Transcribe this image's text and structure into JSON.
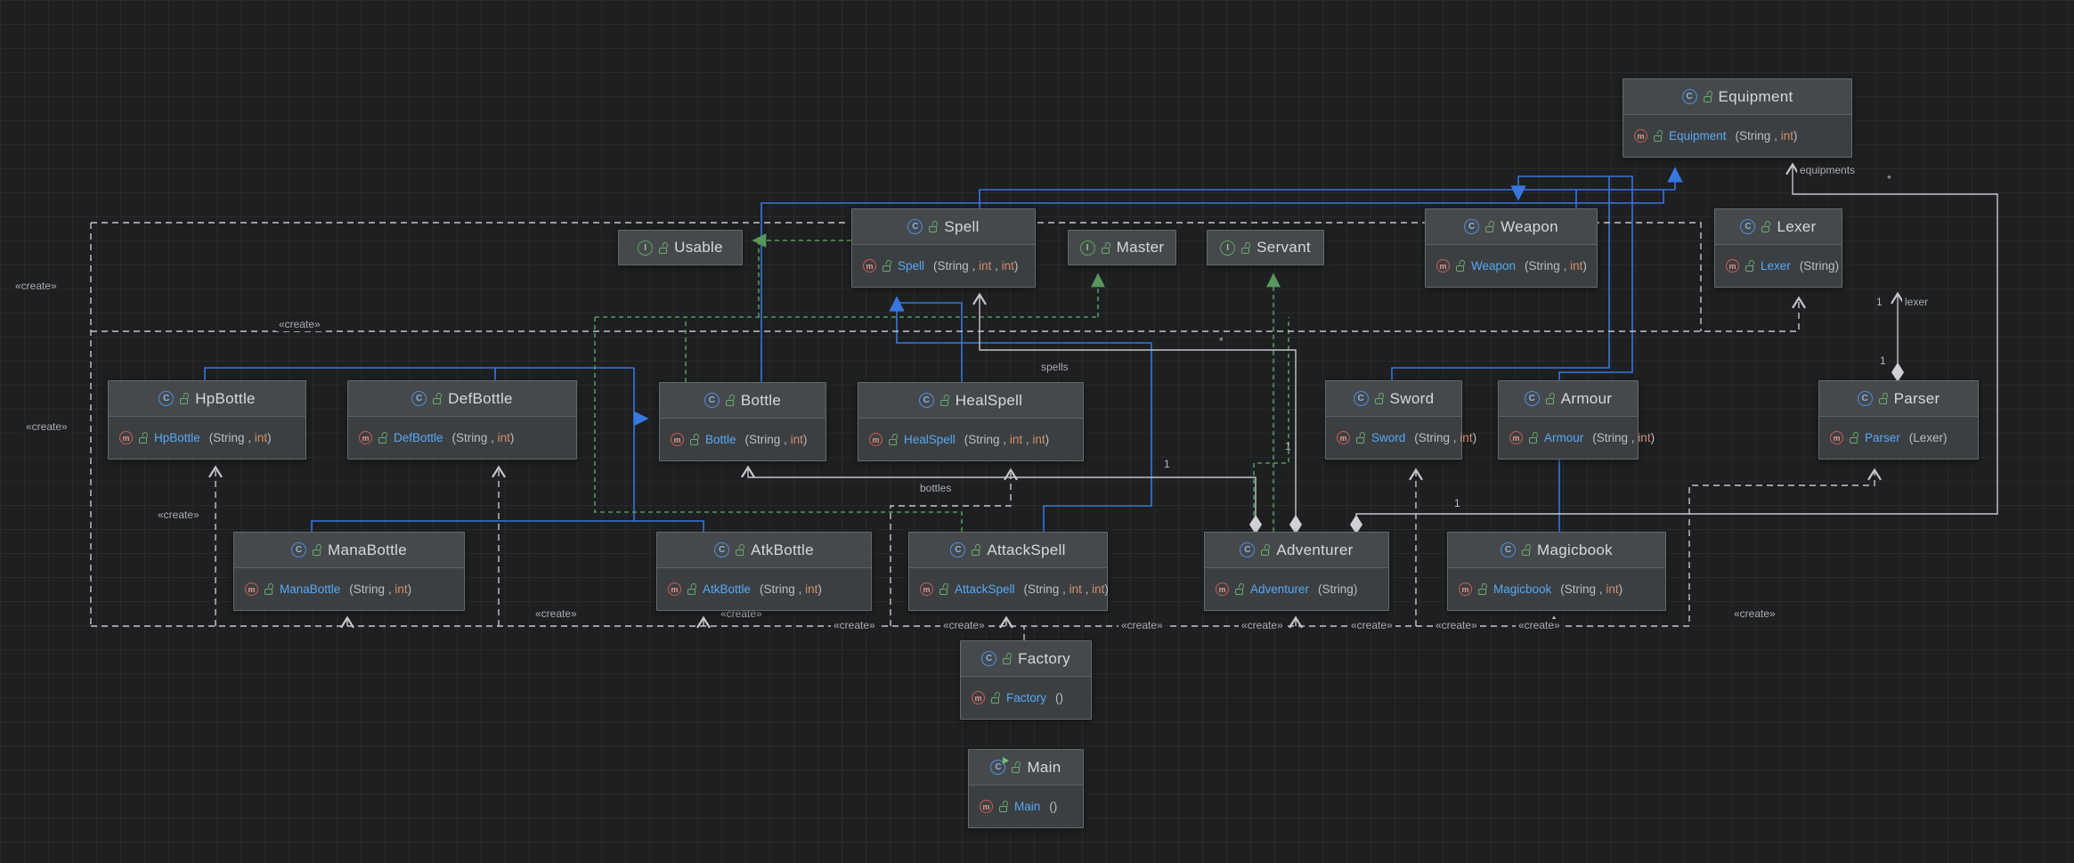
{
  "icons": {
    "class_letter": "C",
    "interface_letter": "I",
    "method_letter": "m"
  },
  "colors": {
    "background": "#1d1f20",
    "node_header": "#46494b",
    "node_body": "#3c3f41",
    "inheritance_edge": "#3876e0",
    "realization_edge": "#57965C",
    "association_edge": "#c4c6ca",
    "class_icon": "#4e8ee0",
    "interface_icon": "#5fa562",
    "method_icon": "#cd5b56",
    "method_name": "#56a8f5",
    "type_int": "#CF8E6D"
  },
  "classes": {
    "equipment": {
      "kind": "class",
      "name": "Equipment",
      "method": "Equipment",
      "params": [
        "String",
        "int"
      ]
    },
    "usable": {
      "kind": "interface",
      "name": "Usable"
    },
    "spell": {
      "kind": "class",
      "name": "Spell",
      "method": "Spell",
      "params": [
        "String",
        "int",
        "int"
      ]
    },
    "master": {
      "kind": "interface",
      "name": "Master"
    },
    "servant": {
      "kind": "interface",
      "name": "Servant"
    },
    "weapon": {
      "kind": "class",
      "name": "Weapon",
      "method": "Weapon",
      "params": [
        "String",
        "int"
      ]
    },
    "lexer": {
      "kind": "class",
      "name": "Lexer",
      "method": "Lexer",
      "params": [
        "String"
      ]
    },
    "hpbottle": {
      "kind": "class",
      "name": "HpBottle",
      "method": "HpBottle",
      "params": [
        "String",
        "int"
      ]
    },
    "defbottle": {
      "kind": "class",
      "name": "DefBottle",
      "method": "DefBottle",
      "params": [
        "String",
        "int"
      ]
    },
    "bottle": {
      "kind": "class",
      "name": "Bottle",
      "method": "Bottle",
      "params": [
        "String",
        "int"
      ]
    },
    "healspell": {
      "kind": "class",
      "name": "HealSpell",
      "method": "HealSpell",
      "params": [
        "String",
        "int",
        "int"
      ]
    },
    "sword": {
      "kind": "class",
      "name": "Sword",
      "method": "Sword",
      "params": [
        "String",
        "int"
      ]
    },
    "armour": {
      "kind": "class",
      "name": "Armour",
      "method": "Armour",
      "params": [
        "String",
        "int"
      ]
    },
    "parser": {
      "kind": "class",
      "name": "Parser",
      "method": "Parser",
      "params": [
        "Lexer"
      ]
    },
    "manabottle": {
      "kind": "class",
      "name": "ManaBottle",
      "method": "ManaBottle",
      "params": [
        "String",
        "int"
      ]
    },
    "atkbottle": {
      "kind": "class",
      "name": "AtkBottle",
      "method": "AtkBottle",
      "params": [
        "String",
        "int"
      ]
    },
    "attackspell": {
      "kind": "class",
      "name": "AttackSpell",
      "method": "AttackSpell",
      "params": [
        "String",
        "int",
        "int"
      ]
    },
    "adventurer": {
      "kind": "class",
      "name": "Adventurer",
      "method": "Adventurer",
      "params": [
        "String"
      ]
    },
    "magicbook": {
      "kind": "class",
      "name": "Magicbook",
      "method": "Magicbook",
      "params": [
        "String",
        "int"
      ]
    },
    "factory": {
      "kind": "class",
      "name": "Factory",
      "method": "Factory",
      "params": []
    },
    "main": {
      "kind": "class",
      "name": "Main",
      "method": "Main",
      "params": []
    }
  },
  "edge_labels": [
    "«create»",
    "«create»",
    "«create»",
    "«create»",
    "«create»",
    "«create»",
    "«create»",
    "«create»",
    "«create»",
    "«create»",
    "«create»",
    "«create»",
    "«create»",
    "«create»",
    "spells",
    "bottles",
    "equipments",
    "*",
    "*",
    "1",
    "1",
    "1",
    "1",
    "1",
    "lexer"
  ]
}
